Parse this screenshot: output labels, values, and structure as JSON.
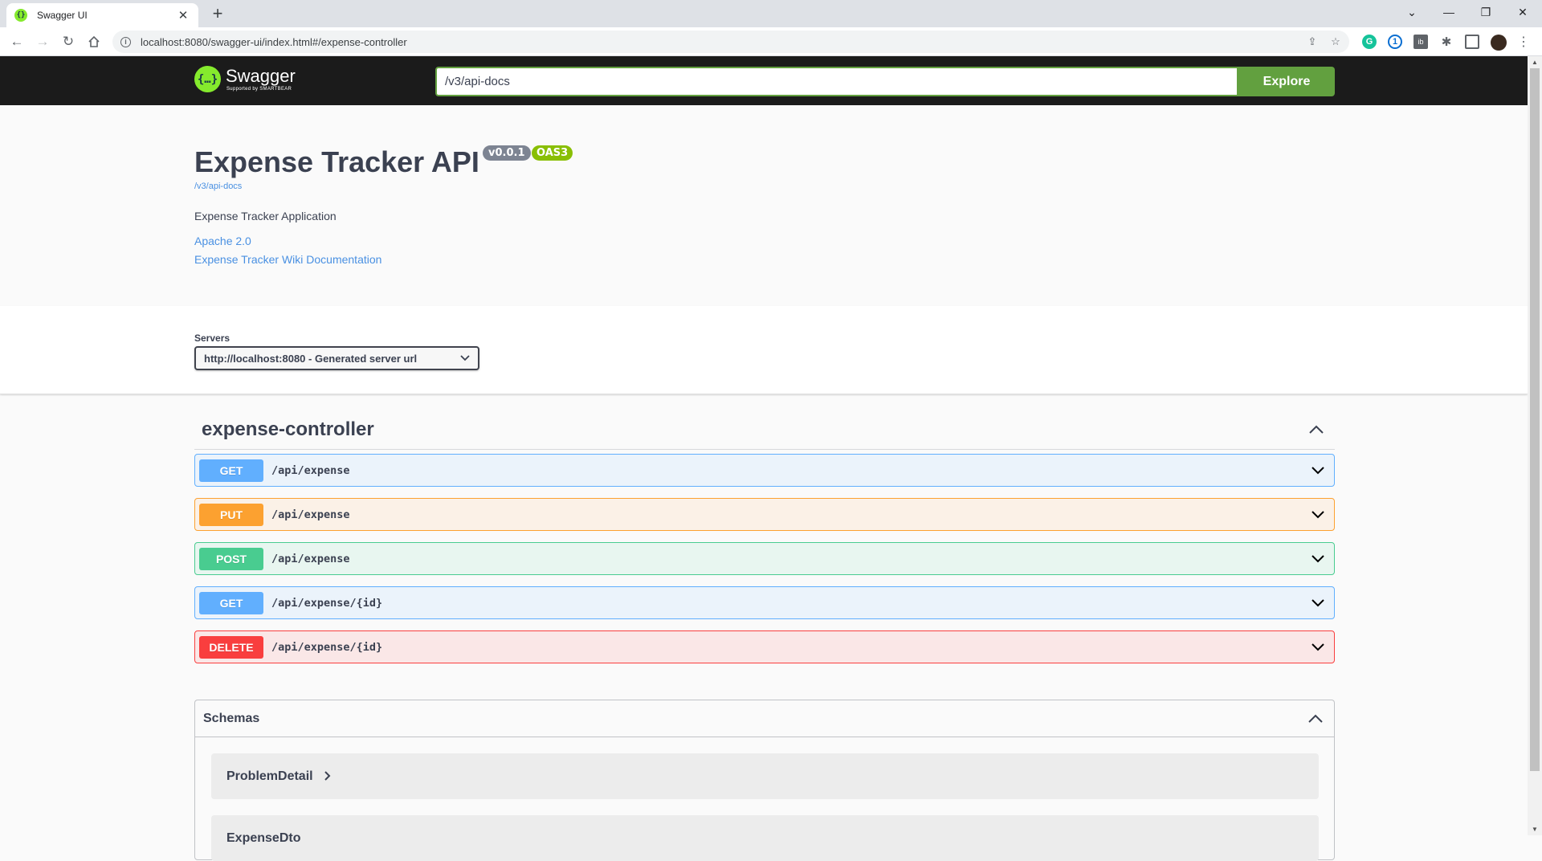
{
  "browser": {
    "tab_title": "Swagger UI",
    "favicon_glyph": "{}",
    "url": "localhost:8080/swagger-ui/index.html#/expense-controller",
    "colors": {
      "tabbar": "#dee1e6",
      "omnibox": "#f1f3f4"
    }
  },
  "swagger_header": {
    "logo_glyph": "{…}",
    "logo_name": "Swagger",
    "logo_sub": "Supported by SMARTBEAR",
    "spec_url": "/v3/api-docs",
    "explore_label": "Explore"
  },
  "info": {
    "title": "Expense Tracker API",
    "version": "v0.0.1",
    "oas": "OAS3",
    "docs_link": "/v3/api-docs",
    "description": "Expense Tracker Application",
    "license": "Apache 2.0",
    "wiki": "Expense Tracker Wiki Documentation"
  },
  "servers": {
    "label": "Servers",
    "selected": "http://localhost:8080 - Generated server url"
  },
  "tag": {
    "name": "expense-controller",
    "expanded": true
  },
  "operations": [
    {
      "method": "GET",
      "path": "/api/expense"
    },
    {
      "method": "PUT",
      "path": "/api/expense"
    },
    {
      "method": "POST",
      "path": "/api/expense"
    },
    {
      "method": "GET",
      "path": "/api/expense/{id}"
    },
    {
      "method": "DELETE",
      "path": "/api/expense/{id}"
    }
  ],
  "schemas": {
    "title": "Schemas",
    "items": [
      "ProblemDetail",
      "ExpenseDto"
    ]
  },
  "colors": {
    "get": "#61affe",
    "put": "#fca130",
    "post": "#49cc90",
    "delete": "#f93e3e",
    "explore": "#62a03f",
    "swagger_green": "#85ea2d"
  }
}
